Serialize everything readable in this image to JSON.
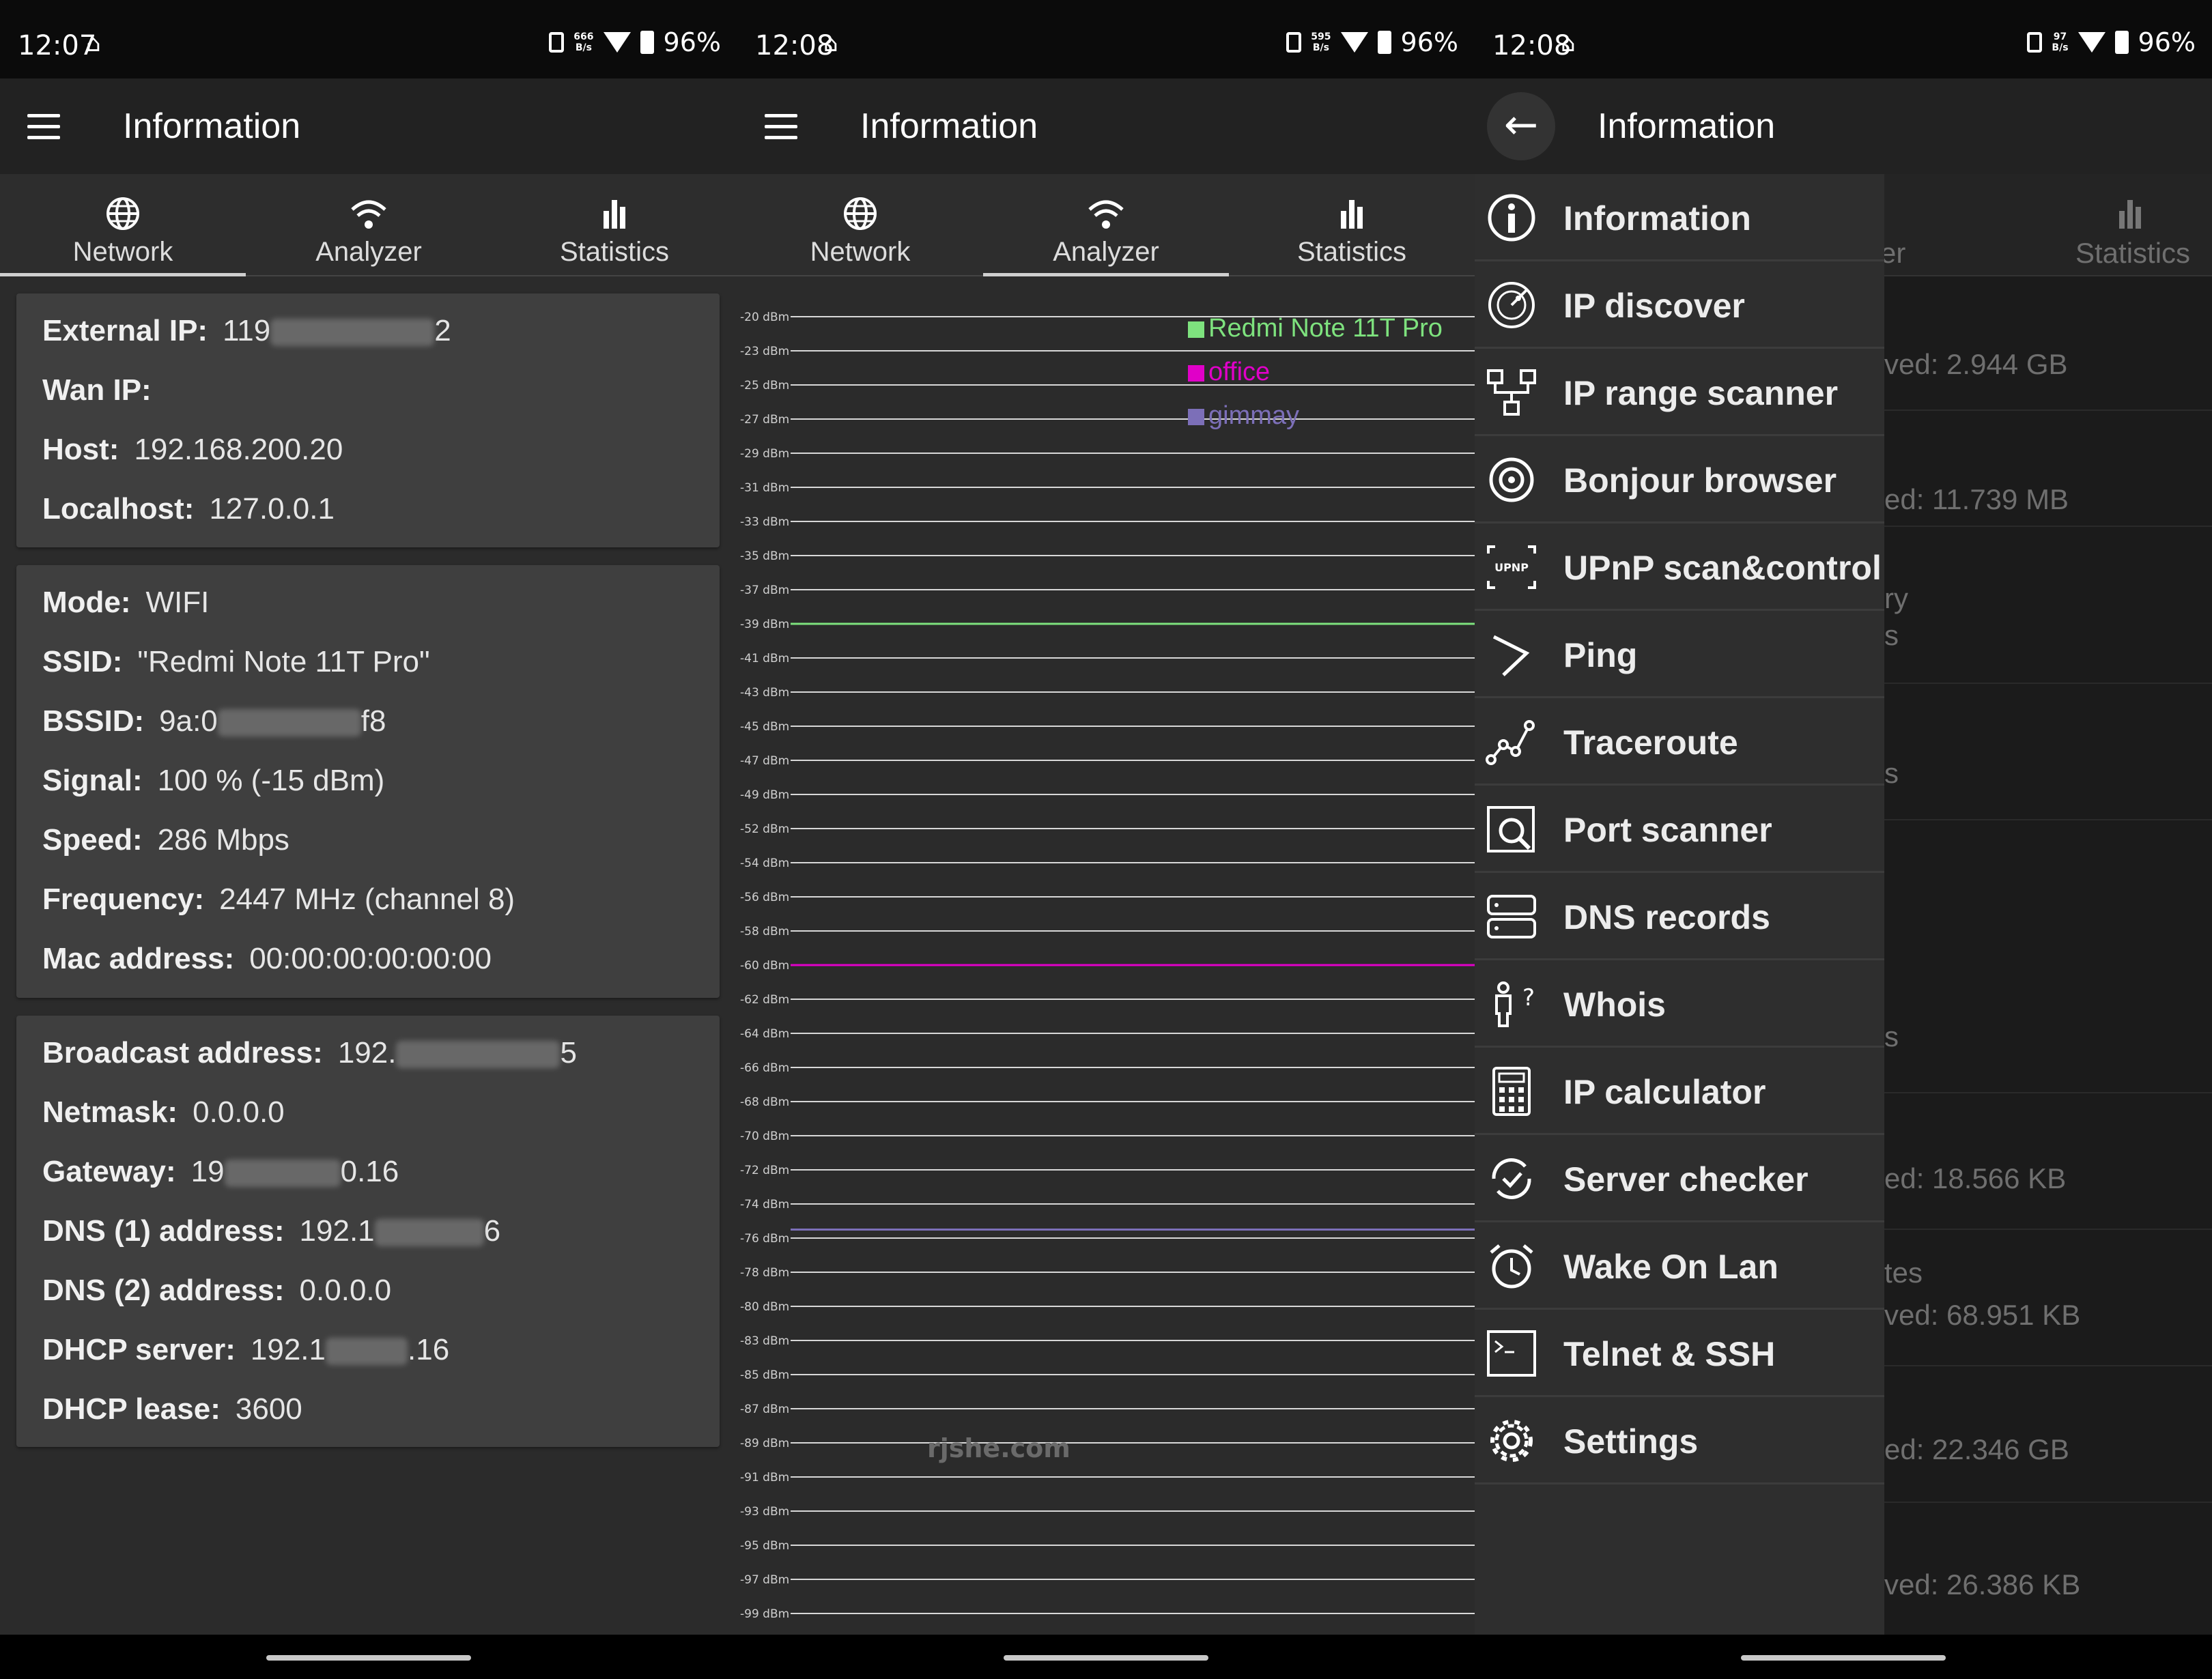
{
  "screens": [
    {
      "status": {
        "time": "12:07",
        "speed_top": "666",
        "speed_unit": "B/s",
        "battery": "96%"
      },
      "title": "Information",
      "tabs": [
        {
          "label": "Network",
          "icon": "globe-icon",
          "active": true
        },
        {
          "label": "Analyzer",
          "icon": "wifi-icon",
          "active": false
        },
        {
          "label": "Statistics",
          "icon": "bar-chart-icon",
          "active": false
        }
      ],
      "card1": [
        {
          "key": "External IP:",
          "pre": "119",
          "post": "2"
        },
        {
          "key": "Wan IP:",
          "pre": "",
          "post": ""
        },
        {
          "key": "Host:",
          "pre": "192.168.200.20",
          "post": ""
        },
        {
          "key": "Localhost:",
          "pre": "127.0.0.1",
          "post": ""
        }
      ],
      "card2": [
        {
          "key": "Mode:",
          "pre": "WIFI",
          "post": ""
        },
        {
          "key": "SSID:",
          "pre": "\"Redmi Note 11T Pro\"",
          "post": ""
        },
        {
          "key": "BSSID:",
          "pre": "9a:0",
          "post": "f8"
        },
        {
          "key": "Signal:",
          "pre": "100 % (-15 dBm)",
          "post": ""
        },
        {
          "key": "Speed:",
          "pre": "286 Mbps",
          "post": ""
        },
        {
          "key": "Frequency:",
          "pre": "2447 MHz (channel 8)",
          "post": ""
        },
        {
          "key": "Mac address:",
          "pre": "00:00:00:00:00:00",
          "post": ""
        }
      ],
      "card3": [
        {
          "key": "Broadcast address:",
          "pre": "192.",
          "post": "5"
        },
        {
          "key": "Netmask:",
          "pre": "0.0.0.0",
          "post": ""
        },
        {
          "key": "Gateway:",
          "pre": "19",
          "post": "0.16"
        },
        {
          "key": "DNS (1) address:",
          "pre": "192.1",
          "post": "6"
        },
        {
          "key": "DNS (2) address:",
          "pre": "0.0.0.0",
          "post": ""
        },
        {
          "key": "DHCP server:",
          "pre": "192.1",
          "post": ".16"
        },
        {
          "key": "DHCP lease:",
          "pre": "3600",
          "post": ""
        }
      ]
    },
    {
      "status": {
        "time": "12:08",
        "speed_top": "595",
        "speed_unit": "B/s",
        "battery": "96%"
      },
      "title": "Information",
      "tabs": [
        {
          "label": "Network",
          "icon": "globe-icon",
          "active": false
        },
        {
          "label": "Analyzer",
          "icon": "wifi-icon",
          "active": true
        },
        {
          "label": "Statistics",
          "icon": "bar-chart-icon",
          "active": false
        }
      ],
      "watermark": "rjshe.com"
    },
    {
      "status": {
        "time": "12:08",
        "speed_top": "97",
        "speed_unit": "B/s",
        "battery": "96%"
      },
      "title": "Information",
      "drawer": [
        {
          "label": "Information",
          "icon": "info-icon"
        },
        {
          "label": "IP discover",
          "icon": "radar-icon"
        },
        {
          "label": "IP range scanner",
          "icon": "network-tree-icon"
        },
        {
          "label": "Bonjour browser",
          "icon": "bonjour-icon"
        },
        {
          "label": "UPnP scan&control",
          "icon": "upnp-icon"
        },
        {
          "label": "Ping",
          "icon": "ping-icon"
        },
        {
          "label": "Traceroute",
          "icon": "traceroute-icon"
        },
        {
          "label": "Port scanner",
          "icon": "port-scanner-icon"
        },
        {
          "label": "DNS records",
          "icon": "server-icon"
        },
        {
          "label": "Whois",
          "icon": "whois-icon"
        },
        {
          "label": "IP calculator",
          "icon": "calculator-icon"
        },
        {
          "label": "Server checker",
          "icon": "server-checker-icon"
        },
        {
          "label": "Wake On Lan",
          "icon": "alarm-clock-icon"
        },
        {
          "label": "Telnet & SSH",
          "icon": "terminal-icon"
        },
        {
          "label": "Settings",
          "icon": "gear-icon"
        }
      ],
      "behind": {
        "tab_partial": "er",
        "tab_stats": "Statistics",
        "texts": [
          "ved: 2.944 GB",
          "ed: 11.739 MB",
          "ry",
          "s",
          "s",
          "s",
          "ed: 18.566 KB",
          "tes",
          "ved: 68.951 KB",
          "ed: 22.346 GB",
          "ved: 26.386 KB"
        ]
      }
    }
  ],
  "chart_data": {
    "type": "line",
    "y_ticks": [
      "-20 dBm",
      "-23 dBm",
      "-25 dBm",
      "-27 dBm",
      "-29 dBm",
      "-31 dBm",
      "-33 dBm",
      "-35 dBm",
      "-37 dBm",
      "-39 dBm",
      "-41 dBm",
      "-43 dBm",
      "-45 dBm",
      "-47 dBm",
      "-49 dBm",
      "-52 dBm",
      "-54 dBm",
      "-56 dBm",
      "-58 dBm",
      "-60 dBm",
      "-62 dBm",
      "-64 dBm",
      "-66 dBm",
      "-68 dBm",
      "-70 dBm",
      "-72 dBm",
      "-74 dBm",
      "-76 dBm",
      "-78 dBm",
      "-80 dBm",
      "-83 dBm",
      "-85 dBm",
      "-87 dBm",
      "-89 dBm",
      "-91 dBm",
      "-93 dBm",
      "-95 dBm",
      "-97 dBm",
      "-99 dBm"
    ],
    "ylim": [
      -99,
      -20
    ],
    "grid": true,
    "legend_position": "top-right",
    "series": [
      {
        "name": "Redmi Note 11T Pro",
        "color": "#7ee27e",
        "value": -39
      },
      {
        "name": "office",
        "color": "#e000c8",
        "value": -60
      },
      {
        "name": "gimmay",
        "color": "#7c6fb8",
        "value": -75.5
      }
    ]
  }
}
